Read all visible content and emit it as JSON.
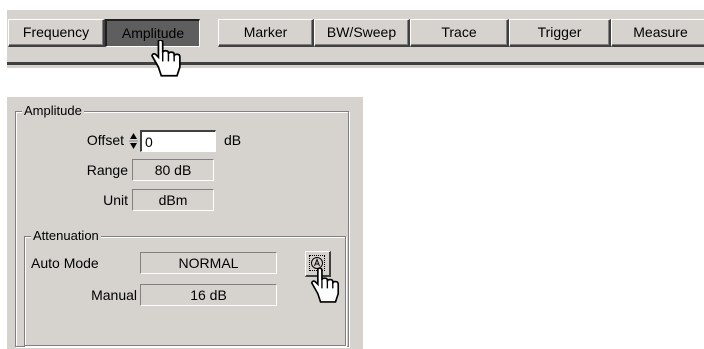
{
  "menu": {
    "tabs": [
      {
        "label": "Frequency"
      },
      {
        "label": "Amplitude",
        "active": true
      },
      {
        "label": "Marker"
      },
      {
        "label": "BW/Sweep"
      },
      {
        "label": "Trace"
      },
      {
        "label": "Trigger"
      },
      {
        "label": "Measure"
      }
    ]
  },
  "amplitude": {
    "title": "Amplitude",
    "offset_label": "Offset",
    "offset_value": "0",
    "offset_unit": "dB",
    "range_label": "Range",
    "range_value": "80 dB",
    "unit_label": "Unit",
    "unit_value": "dBm",
    "attenuation": {
      "title": "Attenuation",
      "auto_mode_label": "Auto Mode",
      "auto_mode_value": "NORMAL",
      "manual_label": "Manual",
      "manual_value": "16 dB"
    }
  },
  "icons": {
    "cursor": "hand-pointer-icon",
    "auto_button": "auto-a-icon"
  }
}
